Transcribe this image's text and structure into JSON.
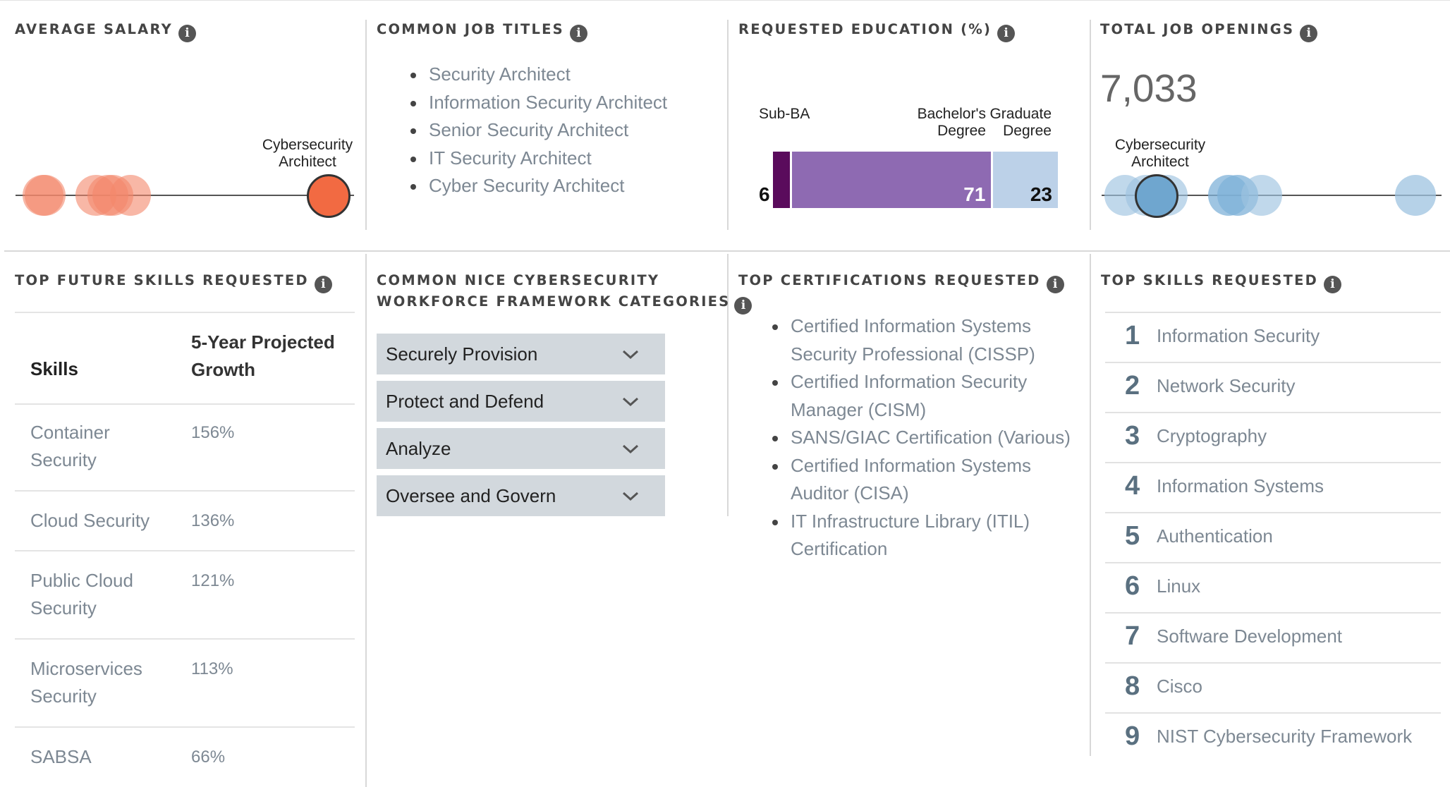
{
  "average_salary": {
    "title": "AVERAGE SALARY",
    "highlight_label": [
      "Cybersecurity",
      "Architect"
    ],
    "colors": {
      "others": "#f4876a",
      "highlight": "#f26a42"
    }
  },
  "job_titles": {
    "title": "COMMON JOB TITLES",
    "items": [
      "Security Architect",
      "Information Security Architect",
      "Senior Security Architect",
      "IT Security Architect",
      "Cyber Security Architect"
    ]
  },
  "education": {
    "title": "REQUESTED EDUCATION (%)",
    "segments": [
      {
        "label": "Sub-BA",
        "value": 6,
        "color": "#5a0b5c"
      },
      {
        "label": "Bachelor's Degree",
        "value": 71,
        "color": "#8e6ab2"
      },
      {
        "label": "Graduate Degree",
        "value": 23,
        "color": "#bcd1e8"
      }
    ],
    "labels": {
      "sub_ba": "Sub-BA",
      "bachelors": [
        "Bachelor's",
        "Degree"
      ],
      "graduate": [
        "Graduate",
        "Degree"
      ]
    }
  },
  "job_openings": {
    "title": "TOTAL JOB OPENINGS",
    "value": "7,033",
    "highlight_label": [
      "Cybersecurity",
      "Architect"
    ],
    "colors": {
      "others": "#9ec3e0",
      "highlight": "#6fa6cf"
    }
  },
  "future_skills": {
    "title": "TOP FUTURE SKILLS REQUESTED",
    "col_skills": "Skills",
    "col_growth": [
      "5-Year Projected",
      "Growth"
    ],
    "rows": [
      {
        "skill": [
          "Container",
          "Security"
        ],
        "growth": "156%"
      },
      {
        "skill": [
          "Cloud Security"
        ],
        "growth": "136%"
      },
      {
        "skill": [
          "Public Cloud",
          "Security"
        ],
        "growth": "121%"
      },
      {
        "skill": [
          "Microservices",
          "Security"
        ],
        "growth": "113%"
      },
      {
        "skill": [
          "SABSA"
        ],
        "growth": "66%"
      }
    ]
  },
  "nice": {
    "title": [
      "COMMON NICE CYBERSECURITY",
      "WORKFORCE FRAMEWORK CATEGORIES"
    ],
    "categories": [
      "Securely Provision",
      "Protect and Defend",
      "Analyze",
      "Oversee and Govern"
    ]
  },
  "certifications": {
    "title": "TOP CERTIFICATIONS REQUESTED",
    "items": [
      [
        "Certified Information Systems",
        "Security Professional (CISSP)"
      ],
      [
        "Certified Information Security",
        "Manager (CISM)"
      ],
      [
        "SANS/GIAC Certification (Various)"
      ],
      [
        "Certified Information Systems",
        "Auditor (CISA)"
      ],
      [
        "IT Infrastructure Library (ITIL)",
        "Certification"
      ]
    ]
  },
  "top_skills": {
    "title": "TOP SKILLS REQUESTED",
    "items": [
      {
        "rank": "1",
        "name": "Information Security"
      },
      {
        "rank": "2",
        "name": "Network Security"
      },
      {
        "rank": "3",
        "name": "Cryptography"
      },
      {
        "rank": "4",
        "name": "Information Systems"
      },
      {
        "rank": "5",
        "name": "Authentication"
      },
      {
        "rank": "6",
        "name": "Linux"
      },
      {
        "rank": "7",
        "name": "Software Development"
      },
      {
        "rank": "8",
        "name": "Cisco"
      },
      {
        "rank": "9",
        "name": "NIST Cybersecurity Framework"
      }
    ]
  },
  "info_glyph": "i"
}
